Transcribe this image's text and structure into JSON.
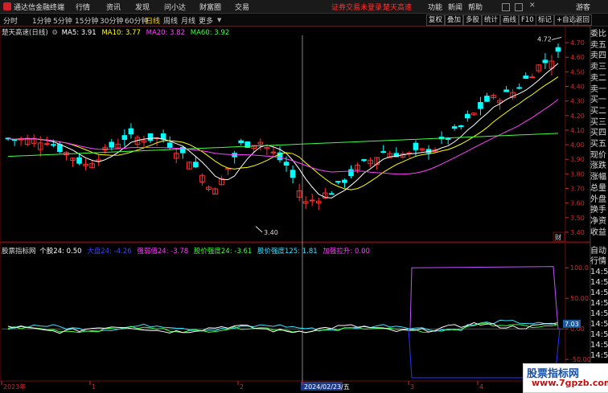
{
  "menubar": {
    "app_title": "通达信金融终端",
    "menu": [
      "行情",
      "资讯",
      "发现",
      "问小达",
      "财富圈",
      "交易"
    ],
    "notice_login": "证券交易未登录",
    "notice_stock": "楚天高速",
    "right_menu": [
      "功能",
      "新闻",
      "帮助",
      "游客"
    ]
  },
  "toolbar": {
    "timeframes": [
      "分时",
      "1分钟",
      "5分钟",
      "15分钟",
      "30分钟",
      "60分钟",
      "日线",
      "周线",
      "月线",
      "更多"
    ],
    "active": "日线",
    "buttons": [
      "复权",
      "叠加",
      "多股",
      "统计",
      "画线",
      "F10",
      "标记",
      "+自选",
      "返回"
    ]
  },
  "main_chart": {
    "stock_name": "楚天高速(日线)",
    "ma": [
      {
        "label": "MA5: 3.91",
        "color": "#ffffff"
      },
      {
        "label": "MA10: 3.77",
        "color": "#ffff00"
      },
      {
        "label": "MA20: 3.82",
        "color": "#ff40ff"
      },
      {
        "label": "MA60: 3.92",
        "color": "#40ff40"
      }
    ],
    "y_ticks": [
      "4.70",
      "4.60",
      "4.50",
      "4.40",
      "4.30",
      "4.20",
      "4.10",
      "4.00",
      "3.90",
      "3.80",
      "3.70",
      "3.60",
      "3.50",
      "3.40"
    ],
    "high_label": "4.72",
    "low_label": "3.40",
    "corner_label": "财"
  },
  "indicator": {
    "name": "股票指标网",
    "items": [
      {
        "label": "个股24: 0.50",
        "color": "#ffffff"
      },
      {
        "label": "大盘24: -4.26",
        "color": "#4040ff"
      },
      {
        "label": "强弱值24: -3.78",
        "color": "#ff40ff"
      },
      {
        "label": "股价强度24: -3.61",
        "color": "#40ff40"
      },
      {
        "label": "股价强度125: 1.81",
        "color": "#40e0ff"
      },
      {
        "label": "加强拉升: 0.00",
        "color": "#ff40ff"
      }
    ],
    "y_ticks": [
      "100.0",
      "50.00",
      "0.00",
      "-50.00"
    ],
    "value_badge": "7.03",
    "x_labels": [
      "2023年",
      "1",
      "2",
      "2024/02/23/五",
      "3",
      "4"
    ]
  },
  "sidebar_top": [
    "委比",
    "卖五",
    "卖四",
    "卖三",
    "卖二",
    "卖一",
    "买一",
    "买二",
    "买三",
    "买四",
    "买五",
    "现价",
    "涨跌",
    "涨幅",
    "总量",
    "外盘",
    "换手",
    "净资",
    "收益"
  ],
  "sidebar_bottom": [
    "自动",
    "行情",
    "14:5",
    "14:5",
    "14:5",
    "14:5",
    "14:5",
    "14:5",
    "14:5",
    "14:5",
    "14:5"
  ],
  "watermark": {
    "line1": "股票指标网",
    "line2": "www.7gpzb.com"
  },
  "colors": {
    "up": "#ff3030",
    "down": "#00ffff",
    "ma5": "#ffffff",
    "ma10": "#ffff00",
    "ma20": "#ff40ff",
    "ma60": "#40ff40"
  }
}
